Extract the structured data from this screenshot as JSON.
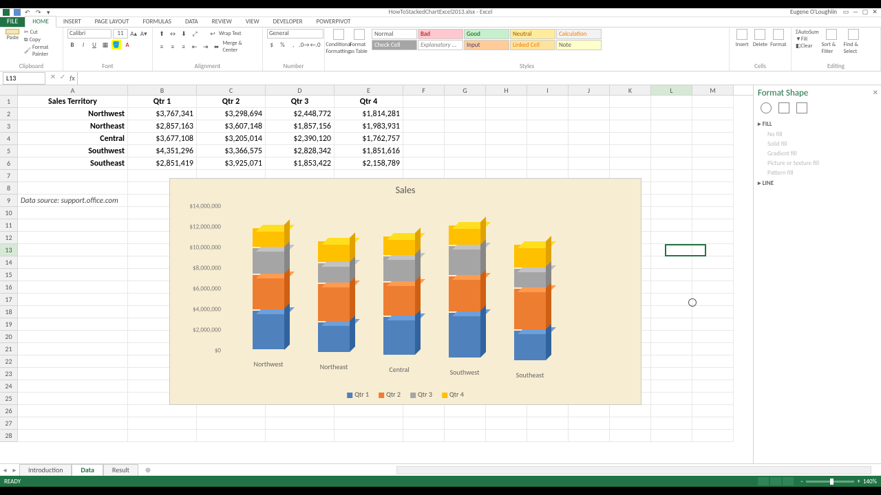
{
  "title": "HowToStackedChartExcel2013.xlsx - Excel",
  "user": "Eugene O'Loughlin",
  "tabs": [
    "FILE",
    "HOME",
    "INSERT",
    "PAGE LAYOUT",
    "FORMULAS",
    "DATA",
    "REVIEW",
    "VIEW",
    "DEVELOPER",
    "POWERPIVOT"
  ],
  "active_tab": "HOME",
  "clipboard": {
    "paste": "Paste",
    "cut": "Cut",
    "copy": "Copy",
    "fmtpaint": "Format Painter",
    "label": "Clipboard"
  },
  "font": {
    "name": "Calibri",
    "size": "11",
    "label": "Font"
  },
  "alignment": {
    "wrap": "Wrap Text",
    "merge": "Merge & Center",
    "label": "Alignment"
  },
  "number": {
    "fmt": "General",
    "label": "Number"
  },
  "styles": {
    "cond": "Conditional Formatting",
    "table": "Format as Table",
    "cell": "Cell Styles",
    "label": "Styles",
    "row1": [
      "Normal",
      "Bad",
      "Good",
      "Neutral",
      "Calculation"
    ],
    "row2": [
      "Check Cell",
      "Explanatory ...",
      "Input",
      "Linked Cell",
      "Note"
    ]
  },
  "cells": {
    "insert": "Insert",
    "delete": "Delete",
    "format": "Format",
    "label": "Cells"
  },
  "editing": {
    "sum": "AutoSum",
    "fill": "Fill",
    "clear": "Clear",
    "sort": "Sort & Filter",
    "find": "Find & Select",
    "label": "Editing"
  },
  "namebox": "L13",
  "columns": [
    "A",
    "B",
    "C",
    "D",
    "E",
    "F",
    "G",
    "H",
    "I",
    "J",
    "K",
    "L",
    "M"
  ],
  "selected_col": "L",
  "selected_row": 13,
  "table": {
    "header": [
      "Sales Territory",
      "Qtr 1",
      "Qtr 2",
      "Qtr 3",
      "Qtr 4"
    ],
    "rows": [
      [
        "Northwest",
        "$3,767,341",
        "$3,298,694",
        "$2,448,772",
        "$1,814,281"
      ],
      [
        "Northeast",
        "$2,857,163",
        "$3,607,148",
        "$1,857,156",
        "$1,983,931"
      ],
      [
        "Central",
        "$3,677,108",
        "$3,205,014",
        "$2,390,120",
        "$1,762,757"
      ],
      [
        "Southwest",
        "$4,351,296",
        "$3,366,575",
        "$2,828,342",
        "$1,851,616"
      ],
      [
        "Southeast",
        "$2,851,419",
        "$3,925,071",
        "$1,853,422",
        "$2,158,789"
      ]
    ]
  },
  "data_source": "Data source: support.office.com",
  "chart_data": {
    "type": "bar",
    "stacked": true,
    "title": "Sales",
    "ylabel": "",
    "ylim": [
      0,
      14000000
    ],
    "yticks": [
      "$14,000,000",
      "$12,000,000",
      "$10,000,000",
      "$8,000,000",
      "$6,000,000",
      "$4,000,000",
      "$2,000,000",
      "$0"
    ],
    "categories": [
      "Northwest",
      "Northeast",
      "Central",
      "Southwest",
      "Southeast"
    ],
    "series": [
      {
        "name": "Qtr 1",
        "color": "#4f81bd",
        "values": [
          3767341,
          2857163,
          3677108,
          4351296,
          2851419
        ]
      },
      {
        "name": "Qtr 2",
        "color": "#ed7d31",
        "values": [
          3298694,
          3607148,
          3205014,
          3366575,
          3925071
        ]
      },
      {
        "name": "Qtr 3",
        "color": "#a5a5a5",
        "values": [
          2448772,
          1857156,
          2390120,
          2828342,
          1853422
        ]
      },
      {
        "name": "Qtr 4",
        "color": "#ffc000",
        "values": [
          1814281,
          1983931,
          1762757,
          1851616,
          2158789
        ]
      }
    ],
    "legend": [
      "Qtr 1",
      "Qtr 2",
      "Qtr 3",
      "Qtr 4"
    ]
  },
  "pane": {
    "title": "Format Shape",
    "fill": "FILL",
    "fill_opts": [
      "No fill",
      "Solid fill",
      "Gradient fill",
      "Picture or texture fill",
      "Pattern fill"
    ],
    "line": "LINE"
  },
  "sheets": [
    "Introduction",
    "Data",
    "Result"
  ],
  "active_sheet": "Data",
  "status": {
    "ready": "READY",
    "zoom": "140%"
  }
}
